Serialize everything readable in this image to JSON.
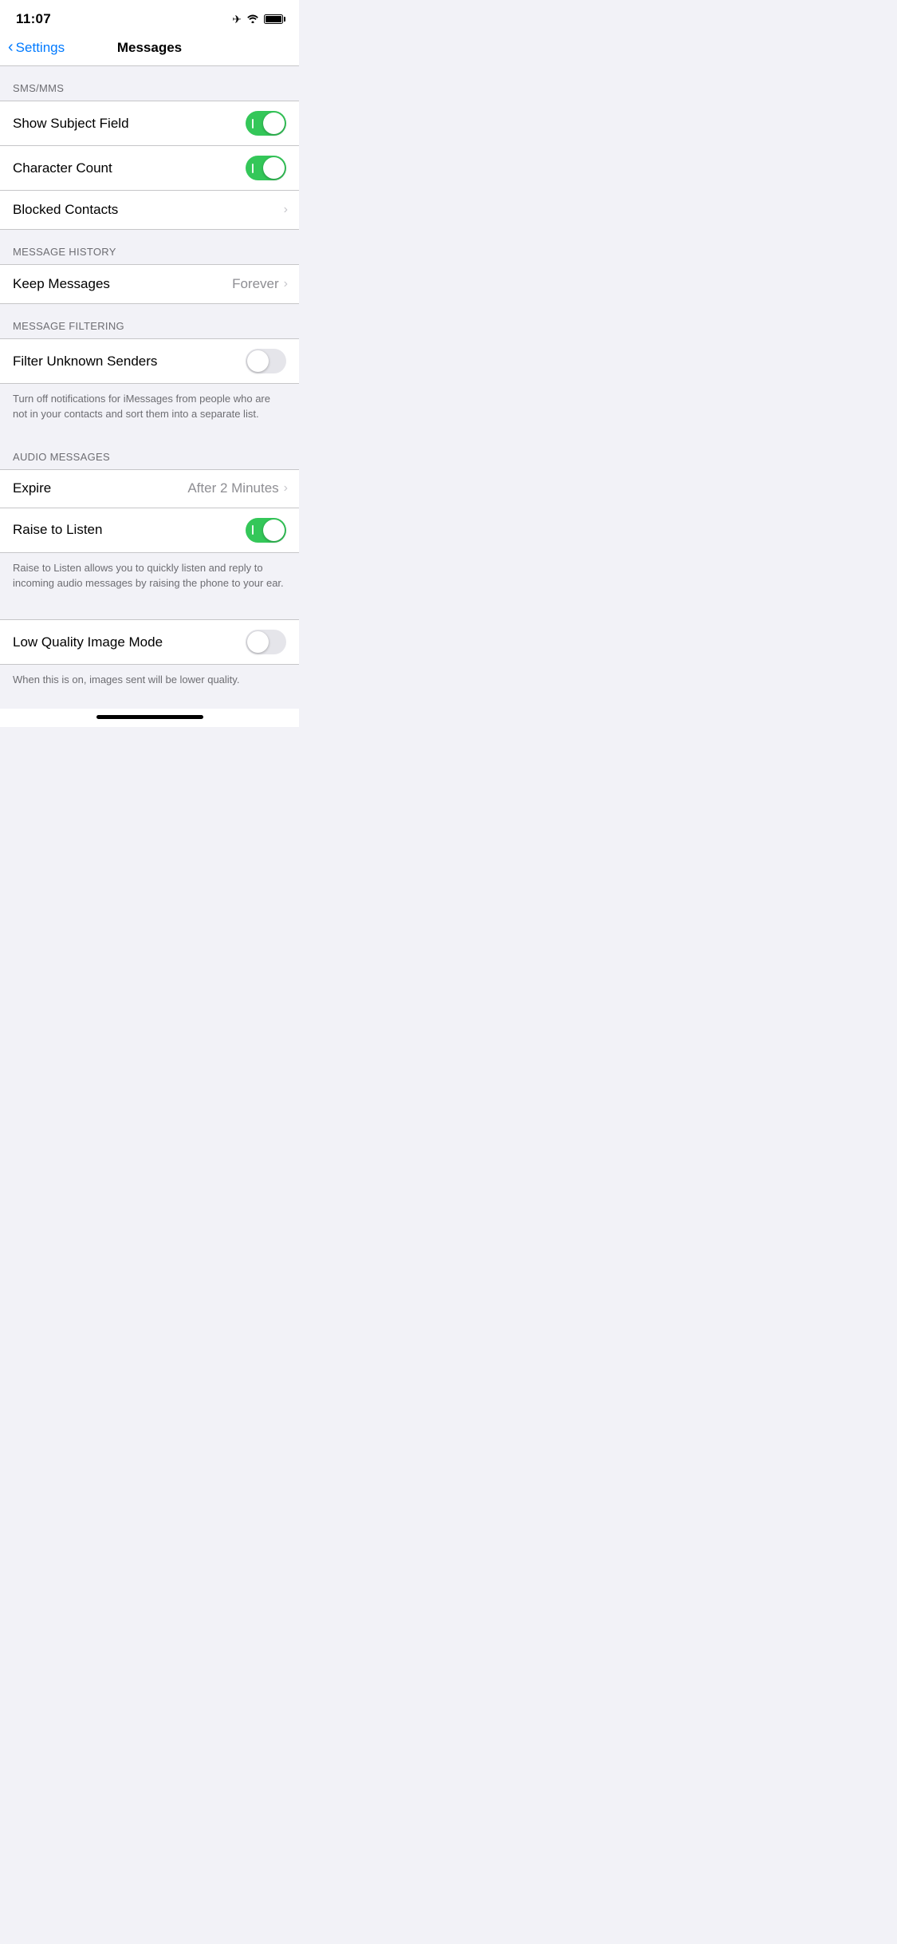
{
  "statusBar": {
    "time": "11:07",
    "icons": [
      "airplane",
      "wifi",
      "battery"
    ]
  },
  "navBar": {
    "backLabel": "Settings",
    "title": "Messages"
  },
  "sections": [
    {
      "id": "sms-mms",
      "header": "SMS/MMS",
      "rows": [
        {
          "id": "show-subject-field",
          "label": "Show Subject Field",
          "type": "toggle",
          "value": true
        },
        {
          "id": "character-count",
          "label": "Character Count",
          "type": "toggle",
          "value": true
        },
        {
          "id": "blocked-contacts",
          "label": "Blocked Contacts",
          "type": "chevron",
          "value": ""
        }
      ]
    },
    {
      "id": "message-history",
      "header": "MESSAGE HISTORY",
      "rows": [
        {
          "id": "keep-messages",
          "label": "Keep Messages",
          "type": "value-chevron",
          "value": "Forever"
        }
      ]
    },
    {
      "id": "message-filtering",
      "header": "MESSAGE FILTERING",
      "rows": [
        {
          "id": "filter-unknown-senders",
          "label": "Filter Unknown Senders",
          "type": "toggle",
          "value": false
        }
      ],
      "description": "Turn off notifications for iMessages from people who are not in your contacts and sort them into a separate list."
    },
    {
      "id": "audio-messages",
      "header": "AUDIO MESSAGES",
      "rows": [
        {
          "id": "expire",
          "label": "Expire",
          "type": "value-chevron",
          "value": "After 2 Minutes"
        },
        {
          "id": "raise-to-listen",
          "label": "Raise to Listen",
          "type": "toggle",
          "value": true
        }
      ],
      "description": "Raise to Listen allows you to quickly listen and reply to incoming audio messages by raising the phone to your ear."
    },
    {
      "id": "low-quality",
      "header": "",
      "rows": [
        {
          "id": "low-quality-image-mode",
          "label": "Low Quality Image Mode",
          "type": "toggle",
          "value": false
        }
      ],
      "description": "When this is on, images sent will be lower quality."
    }
  ],
  "homeIndicator": "home-bar"
}
